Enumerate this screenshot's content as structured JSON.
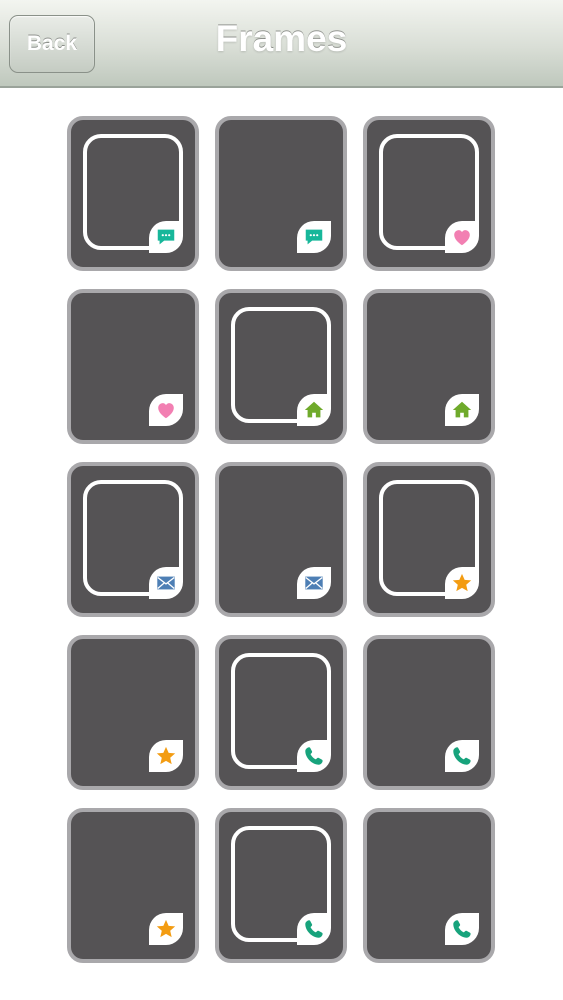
{
  "navbar": {
    "back_label": "Back",
    "title": "Frames"
  },
  "icon_colors": {
    "chat": "#17b79a",
    "heart": "#f27fb2",
    "home": "#6faa2b",
    "mail": "#4e7fb5",
    "star": "#f39c12",
    "phone": "#17a37c"
  },
  "tiles": [
    {
      "frame": true,
      "icon": "chat-icon"
    },
    {
      "frame": false,
      "icon": "chat-icon"
    },
    {
      "frame": true,
      "icon": "heart-icon"
    },
    {
      "frame": false,
      "icon": "heart-icon"
    },
    {
      "frame": true,
      "icon": "home-icon"
    },
    {
      "frame": false,
      "icon": "home-icon"
    },
    {
      "frame": true,
      "icon": "mail-icon"
    },
    {
      "frame": false,
      "icon": "mail-icon"
    },
    {
      "frame": true,
      "icon": "star-icon"
    },
    {
      "frame": false,
      "icon": "star-icon"
    },
    {
      "frame": true,
      "icon": "phone-icon"
    },
    {
      "frame": false,
      "icon": "phone-icon"
    },
    {
      "frame": false,
      "icon": "star-icon"
    },
    {
      "frame": true,
      "icon": "phone-icon"
    },
    {
      "frame": false,
      "icon": "phone-icon"
    }
  ]
}
